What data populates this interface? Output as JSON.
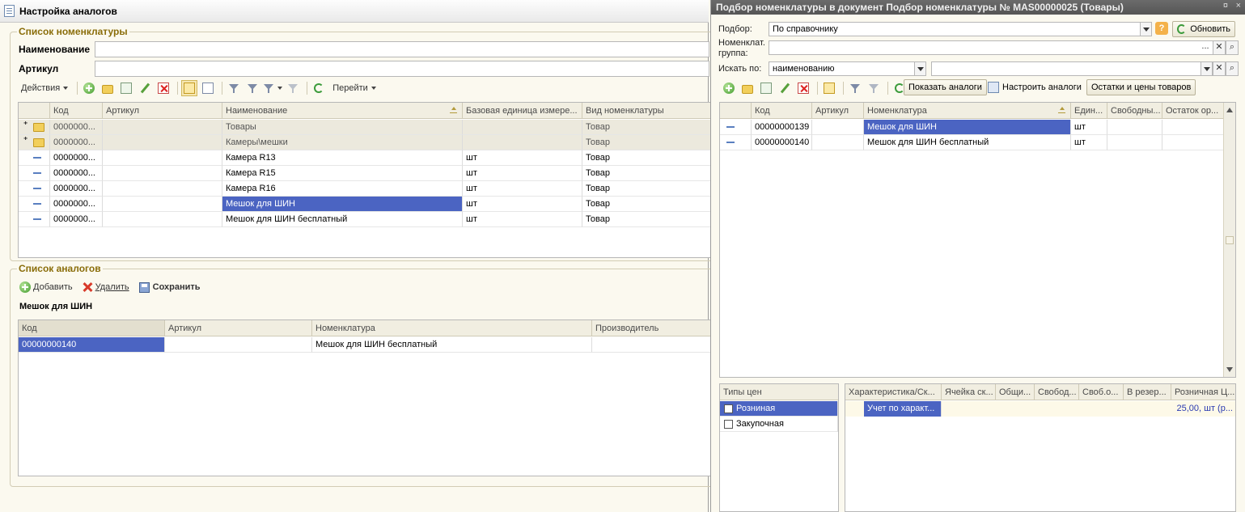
{
  "left": {
    "title": "Настройка аналогов",
    "nomen_group": "Список номенклатуры",
    "name_label": "Наименование",
    "name_value": "",
    "article_label": "Артикул",
    "article_value": "",
    "toolbar": {
      "actions": "Действия",
      "goto": "Перейти"
    },
    "columns": [
      "Код",
      "Артикул",
      "Наименование",
      "Базовая единица измере...",
      "Вид номенклатуры"
    ],
    "rows": [
      {
        "code": "0000000...",
        "article": "",
        "name": "Товары",
        "unit": "",
        "kind": "Товар",
        "type": "folder"
      },
      {
        "code": "0000000...",
        "article": "",
        "name": "Камеры\\мешки",
        "unit": "",
        "kind": "Товар",
        "type": "folder"
      },
      {
        "code": "0000000...",
        "article": "",
        "name": "Камера R13",
        "unit": "шт",
        "kind": "Товар",
        "type": "item"
      },
      {
        "code": "0000000...",
        "article": "",
        "name": "Камера R15",
        "unit": "шт",
        "kind": "Товар",
        "type": "item"
      },
      {
        "code": "0000000...",
        "article": "",
        "name": "Камера R16",
        "unit": "шт",
        "kind": "Товар",
        "type": "item"
      },
      {
        "code": "0000000...",
        "article": "",
        "name": "Мешок для ШИН",
        "unit": "шт",
        "kind": "Товар",
        "type": "item"
      },
      {
        "code": "0000000...",
        "article": "",
        "name": "Мешок для ШИН бесплатный",
        "unit": "шт",
        "kind": "Товар",
        "type": "item"
      }
    ],
    "analogs_group": "Список аналогов",
    "analogs_toolbar": {
      "add": "Добавить",
      "delete": "Удалить",
      "save": "Сохранить"
    },
    "analog_item": "Мешок для ШИН",
    "analog_columns": [
      "Код",
      "Артикул",
      "Номенклатура",
      "Производитель"
    ],
    "analog_rows": [
      {
        "code": "00000000140",
        "article": "",
        "nomen": "Мешок для ШИН бесплатный",
        "maker": ""
      }
    ]
  },
  "right": {
    "title": "Подбор номенклатуры в документ Подбор номенклатуры № MAS00000025 (Товары)",
    "title_controls": [
      "¤",
      "×"
    ],
    "selection_label": "Подбор:",
    "selection_value": "По справочнику",
    "refresh": "Обновить",
    "group_label_1": "Номенклат.",
    "group_label_2": "группа:",
    "group_value": "",
    "search_label": "Искать по:",
    "search_by": "наименованию",
    "search_value": "",
    "buttons": {
      "show_analogs": "Показать аналоги",
      "config_analogs": "Настроить аналоги",
      "stock_prices": "Остатки и цены товаров"
    },
    "columns": [
      "Код",
      "Артикул",
      "Номенклатура",
      "Един...",
      "Свободны...",
      "Остаток ор..."
    ],
    "rows": [
      {
        "code": "00000000139",
        "article": "",
        "nomen": "Мешок для ШИН",
        "unit": "шт",
        "free": "",
        "rest": ""
      },
      {
        "code": "00000000140",
        "article": "",
        "nomen": "Мешок для ШИН бесплатный",
        "unit": "шт",
        "free": "",
        "rest": ""
      }
    ],
    "price_types_header": "Типы цен",
    "price_types": [
      {
        "label": "Розниная",
        "checked": true
      },
      {
        "label": "Закупочная",
        "checked": false
      }
    ],
    "detail_columns": [
      "Характеристика/Ск...",
      "Ячейка ск...",
      "Общи...",
      "Свобод...",
      "Своб.о...",
      "В резер...",
      "Розничная Ц..."
    ],
    "detail_row": {
      "char": "Учет по характ...",
      "price": "25,00, шт (р..."
    }
  }
}
